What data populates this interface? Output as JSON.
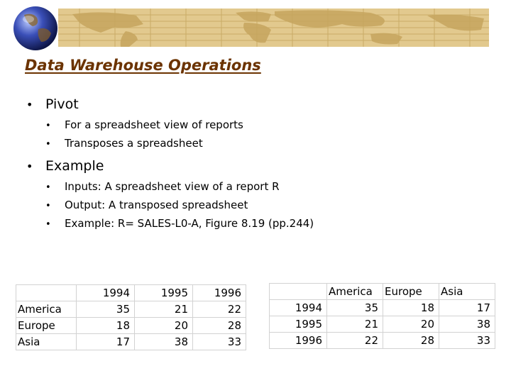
{
  "slide": {
    "title": "Data Warehouse Operations",
    "bullets": [
      {
        "text": "Pivot",
        "sub": [
          "For a spreadsheet view of reports",
          "Transposes a spreadsheet"
        ]
      },
      {
        "text": "Example",
        "sub": [
          "Inputs: A spreadsheet view of a report R",
          "Output: A transposed spreadsheet",
          "Example: R= SALES-L0-A, Figure 8.19 (pp.244)"
        ]
      }
    ],
    "bullet_glyph": "•"
  },
  "table_original": {
    "header": [
      "",
      "1994",
      "1995",
      "1996"
    ],
    "rows": [
      [
        "America",
        "35",
        "21",
        "22"
      ],
      [
        "Europe",
        "18",
        "20",
        "28"
      ],
      [
        "Asia",
        "17",
        "38",
        "33"
      ]
    ]
  },
  "table_transposed": {
    "header": [
      "",
      "America",
      "Europe",
      "Asia"
    ],
    "rows": [
      [
        "1994",
        "35",
        "18",
        "17"
      ],
      [
        "1995",
        "21",
        "20",
        "38"
      ],
      [
        "1996",
        "22",
        "28",
        "33"
      ]
    ]
  },
  "colors": {
    "title": "#6b3300",
    "banner": "#e2c98e",
    "map_lines": "#c9ac66"
  },
  "icons": {
    "globe": "globe-icon",
    "banner": "world-map-banner"
  }
}
